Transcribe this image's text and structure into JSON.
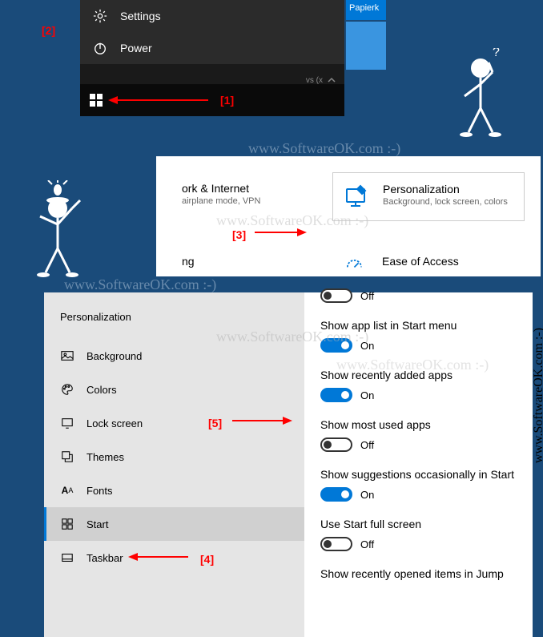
{
  "annotations": {
    "a1": "[1]",
    "a2": "[2]",
    "a3": "[3]",
    "a4": "[4]",
    "a5": "[5]"
  },
  "start_menu": {
    "settings_label": "Settings",
    "power_label": "Power",
    "tray_text": "vs (x"
  },
  "tile": {
    "label": "Papierk"
  },
  "categories": {
    "network": {
      "title": "ork & Internet",
      "subtitle": "airplane mode, VPN"
    },
    "personalization": {
      "title": "Personalization",
      "subtitle": "Background, lock screen, colors"
    },
    "gaming": {
      "title": "ng"
    },
    "ease": {
      "title": "Ease of Access"
    }
  },
  "sidebar": {
    "title": "Personalization",
    "items": {
      "background": "Background",
      "colors": "Colors",
      "lockscreen": "Lock screen",
      "themes": "Themes",
      "fonts": "Fonts",
      "start": "Start",
      "taskbar": "Taskbar"
    }
  },
  "settings": {
    "off_partial": "Off",
    "app_list": {
      "label": "Show app list in Start menu",
      "state": "On"
    },
    "recent_apps": {
      "label": "Show recently added apps",
      "state": "On"
    },
    "most_used": {
      "label": "Show most used apps",
      "state": "Off"
    },
    "suggestions": {
      "label": "Show suggestions occasionally in Start",
      "state": "On"
    },
    "fullscreen": {
      "label": "Use Start full screen",
      "state": "Off"
    },
    "jump_list": {
      "label": "Show recently opened items in Jump"
    }
  },
  "watermark": "www.SoftwareOK.com :-)"
}
